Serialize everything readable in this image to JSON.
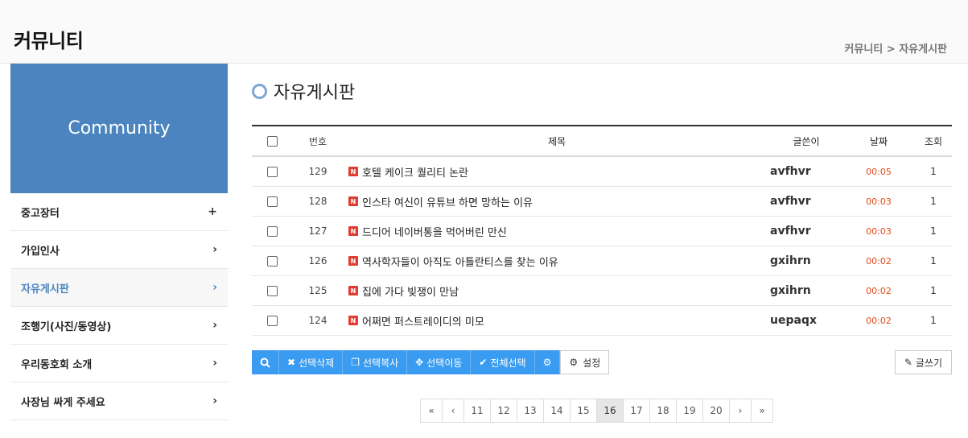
{
  "header": {
    "site_title": "커뮤니티",
    "breadcrumb": "커뮤니티 > 자유게시판"
  },
  "sidebar": {
    "banner": "Community",
    "items": [
      {
        "label": "중고장터",
        "arrow": "+"
      },
      {
        "label": "가입인사",
        "arrow": "›"
      },
      {
        "label": "자유게시판",
        "arrow": "›"
      },
      {
        "label": "조행기(사진/동영상)",
        "arrow": "›"
      },
      {
        "label": "우리동호회 소개",
        "arrow": "›"
      },
      {
        "label": "사장님 싸게 주세요",
        "arrow": "›"
      }
    ]
  },
  "board": {
    "title": "자유게시판",
    "columns": {
      "num": "번호",
      "subject": "제목",
      "writer": "글쓴이",
      "date": "날짜",
      "hits": "조회"
    },
    "new_badge": "N",
    "rows": [
      {
        "num": "129",
        "subject": "호텔 케이크 퀄리티 논란",
        "writer": "avfhvr",
        "date": "00:05",
        "hits": "1"
      },
      {
        "num": "128",
        "subject": "인스타 여신이 유튜브 하면 망하는 이유",
        "writer": "avfhvr",
        "date": "00:03",
        "hits": "1"
      },
      {
        "num": "127",
        "subject": "드디어 네이버통을 먹어버린 만신",
        "writer": "avfhvr",
        "date": "00:03",
        "hits": "1"
      },
      {
        "num": "126",
        "subject": "역사학자들이 아직도 아틀란티스를 찾는 이유",
        "writer": "gxihrn",
        "date": "00:02",
        "hits": "1"
      },
      {
        "num": "125",
        "subject": "집에 가다 빚쟁이 만남",
        "writer": "gxihrn",
        "date": "00:02",
        "hits": "1"
      },
      {
        "num": "124",
        "subject": "어쩌면 퍼스트레이디의 미모",
        "writer": "uepaqx",
        "date": "00:02",
        "hits": "1"
      }
    ]
  },
  "toolbar": {
    "delete_label": "선택삭제",
    "copy_label": "선택복사",
    "move_label": "선택이동",
    "select_all_label": "전체선택",
    "settings_label": "설정",
    "write_label": "글쓰기"
  },
  "pagination": {
    "first": "«",
    "prev": "‹",
    "pages": [
      "11",
      "12",
      "13",
      "14",
      "15",
      "16",
      "17",
      "18",
      "19",
      "20"
    ],
    "current": "16",
    "next": "›",
    "last": "»"
  },
  "colors": {
    "accent": "#4b84be",
    "button": "#3a9cf0",
    "date": "#e04a1a",
    "new_badge": "#e03c31"
  }
}
